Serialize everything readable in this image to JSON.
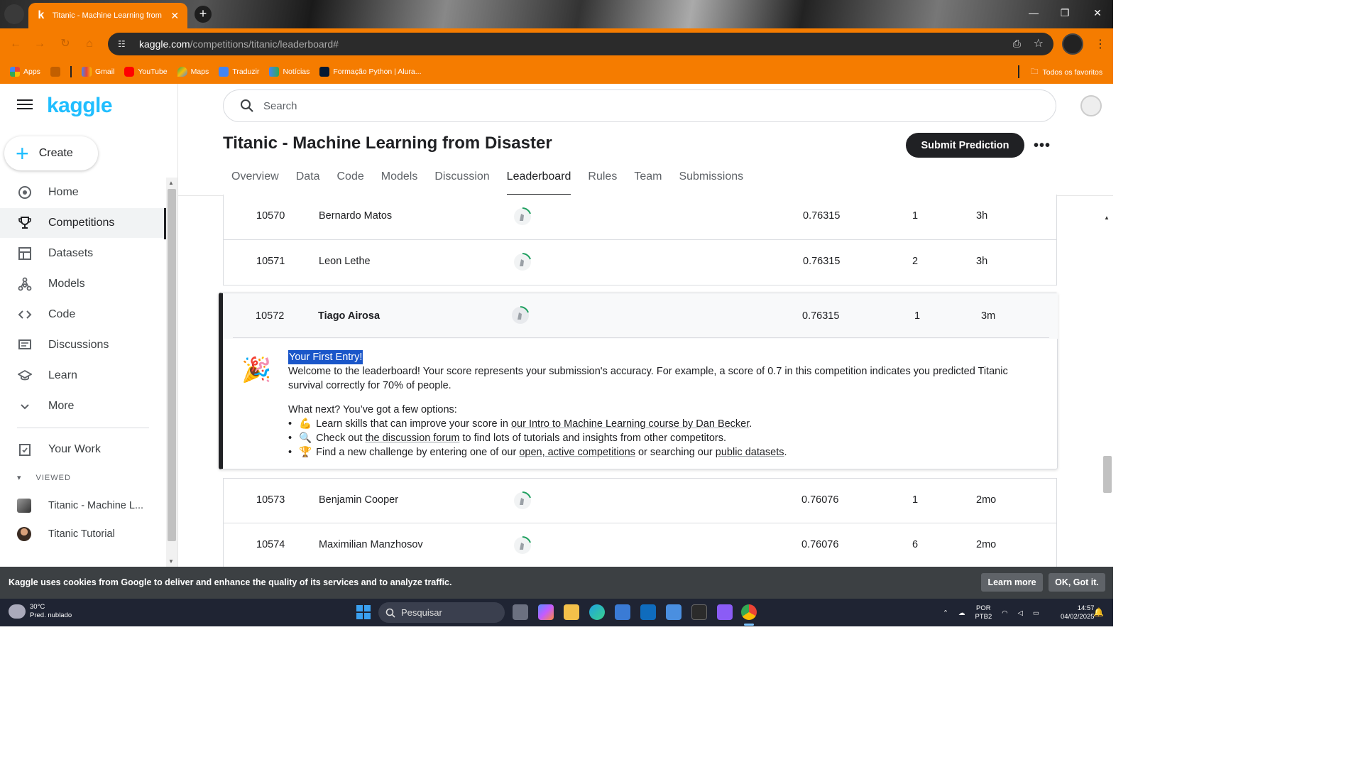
{
  "browser": {
    "tab_title": "Titanic - Machine Learning from Disaster",
    "tab_favicon": "k",
    "url_domain": "kaggle.com",
    "url_path": "/competitions/titanic/leaderboard#",
    "bookmarks": [
      {
        "label": "Apps",
        "icon": "apps-icon",
        "color": "#e94235"
      },
      {
        "label": "Gmail",
        "icon": "gmail-icon",
        "color": "#ea4335"
      },
      {
        "label": "YouTube",
        "icon": "youtube-icon",
        "color": "#ff0000"
      },
      {
        "label": "Maps",
        "icon": "maps-icon",
        "color": "#34a853"
      },
      {
        "label": "Traduzir",
        "icon": "translate-icon",
        "color": "#4285f4"
      },
      {
        "label": "Notícias",
        "icon": "news-icon",
        "color": "#4285f4"
      },
      {
        "label": "Formação Python | Alura...",
        "icon": "alura-icon",
        "color": "#051933"
      }
    ],
    "all_bookmarks": "Todos os favoritos"
  },
  "sidebar": {
    "logo": "kaggle",
    "create_label": "Create",
    "items": [
      {
        "label": "Home",
        "icon": "compass-icon"
      },
      {
        "label": "Competitions",
        "icon": "trophy-icon",
        "active": true
      },
      {
        "label": "Datasets",
        "icon": "table-icon"
      },
      {
        "label": "Models",
        "icon": "models-icon"
      },
      {
        "label": "Code",
        "icon": "code-icon"
      },
      {
        "label": "Discussions",
        "icon": "comments-icon"
      },
      {
        "label": "Learn",
        "icon": "school-icon"
      },
      {
        "label": "More",
        "icon": "chevron-down-icon"
      }
    ],
    "your_work": "Your Work",
    "viewed_label": "VIEWED",
    "viewed": [
      {
        "label": "Titanic - Machine L..."
      },
      {
        "label": "Titanic Tutorial"
      }
    ]
  },
  "header": {
    "search_placeholder": "Search",
    "competition_title": "Titanic - Machine Learning from Disaster",
    "submit_label": "Submit Prediction",
    "more_label": "•••",
    "tabs": [
      "Overview",
      "Data",
      "Code",
      "Models",
      "Discussion",
      "Leaderboard",
      "Rules",
      "Team",
      "Submissions"
    ],
    "active_tab": "Leaderboard"
  },
  "leaderboard": {
    "rows_before": [
      {
        "rank": "10570",
        "name": "Bernardo Matos",
        "score": "0.76315",
        "entries": "1",
        "last": "3h"
      },
      {
        "rank": "10571",
        "name": "Leon Lethe",
        "score": "0.76315",
        "entries": "2",
        "last": "3h"
      }
    ],
    "highlight": {
      "rank": "10572",
      "name": "Tiago Airosa",
      "score": "0.76315",
      "entries": "1",
      "last": "3m"
    },
    "rows_after": [
      {
        "rank": "10573",
        "name": "Benjamin Cooper",
        "score": "0.76076",
        "entries": "1",
        "last": "2mo"
      },
      {
        "rank": "10574",
        "name": "Maximilian Manzhosov",
        "score": "0.76076",
        "entries": "6",
        "last": "2mo"
      }
    ]
  },
  "first_entry": {
    "title": "Your First Entry!",
    "welcome": "Welcome to the leaderboard! Your score represents your submission's accuracy. For example, a score of 0.7 in this competition indicates you predicted Titanic survival correctly for 70% of people.",
    "next": "What next? You’ve got a few options:",
    "opt1_pre": "Learn skills that can improve your score in ",
    "opt1_link": "our Intro to Machine Learning course by Dan Becker",
    "opt1_post": ".",
    "opt2_pre": "Check out ",
    "opt2_link": "the discussion forum",
    "opt2_post": " to find lots of tutorials and insights from other competitors.",
    "opt3_pre": "Find a new challenge by entering one of our ",
    "opt3_link1": "open, active competitions",
    "opt3_mid": " or searching our ",
    "opt3_link2": "public datasets",
    "opt3_post": "."
  },
  "cookie": {
    "text": "Kaggle uses cookies from Google to deliver and enhance the quality of its services and to analyze traffic.",
    "learn_more": "Learn more",
    "ok": "OK, Got it."
  },
  "taskbar": {
    "temp": "30°C",
    "weather": "Pred. nublado",
    "search": "Pesquisar",
    "lang1": "POR",
    "lang2": "PTB2",
    "time": "14:57",
    "date": "04/02/2025"
  }
}
